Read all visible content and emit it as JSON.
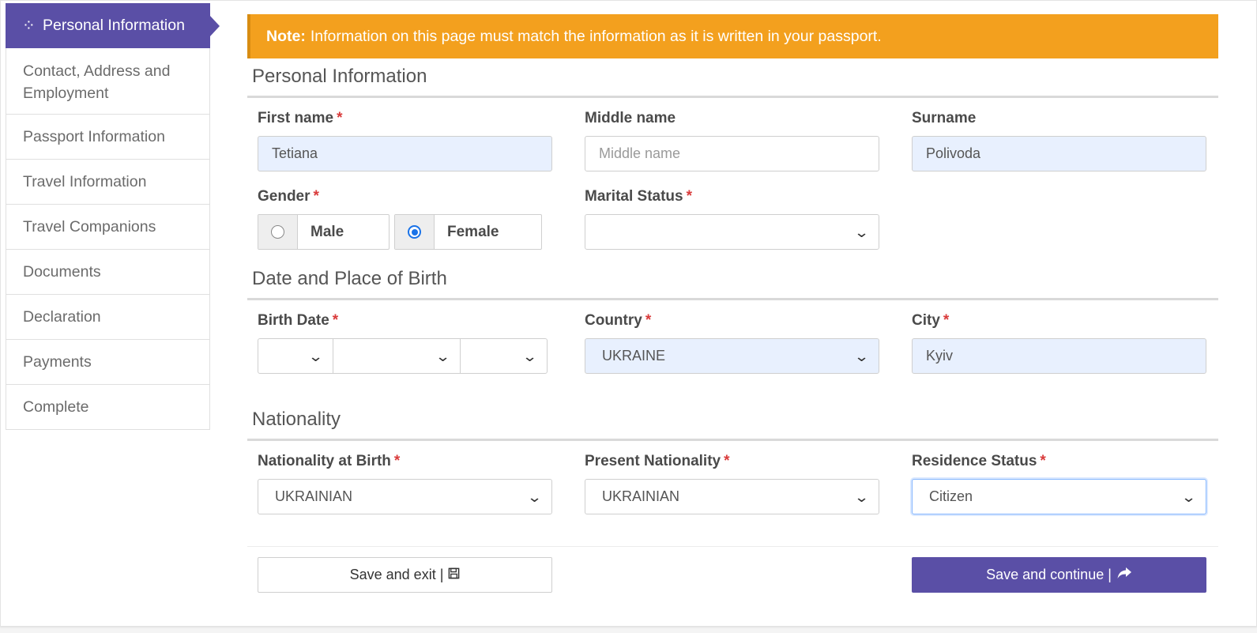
{
  "sidebar": {
    "items": [
      {
        "label": "Personal Information",
        "icon": "spinner-icon",
        "active": true
      },
      {
        "label_line1": "Contact, Address and",
        "label_line2": "Employment"
      },
      {
        "label": "Passport Information"
      },
      {
        "label": "Travel Information"
      },
      {
        "label": "Travel Companions"
      },
      {
        "label": "Documents"
      },
      {
        "label": "Declaration"
      },
      {
        "label": "Payments"
      },
      {
        "label": "Complete"
      }
    ]
  },
  "note": {
    "prefix": "Note:",
    "text": "Information on this page must match the information as it is written in your passport."
  },
  "sections": {
    "personal": {
      "title": "Personal Information",
      "first_name": {
        "label": "First name",
        "value": "Tetiana"
      },
      "middle_name": {
        "label": "Middle name",
        "placeholder": "Middle name"
      },
      "surname": {
        "label": "Surname",
        "value": "Polivoda"
      },
      "gender": {
        "label": "Gender",
        "options": [
          "Male",
          "Female"
        ],
        "selected": "Female"
      },
      "marital_status": {
        "label": "Marital Status",
        "value": ""
      }
    },
    "birth": {
      "title": "Date and Place of Birth",
      "birth_date": {
        "label": "Birth Date",
        "day": "",
        "month": "",
        "year": ""
      },
      "country": {
        "label": "Country",
        "value": "UKRAINE"
      },
      "city": {
        "label": "City",
        "value": "Kyiv"
      }
    },
    "nationality": {
      "title": "Nationality",
      "at_birth": {
        "label": "Nationality at Birth",
        "value": "UKRAINIAN"
      },
      "present": {
        "label": "Present Nationality",
        "value": "UKRAINIAN"
      },
      "residence": {
        "label": "Residence Status",
        "value": "Citizen"
      }
    }
  },
  "required_marker": "*",
  "actions": {
    "save_exit": "Save and exit |",
    "save_continue": "Save and continue |"
  },
  "colors": {
    "accent": "#5a4fa6",
    "note_bg": "#f3a01e",
    "required": "#d93b3b",
    "autofill_bg": "#e8f0fe"
  }
}
